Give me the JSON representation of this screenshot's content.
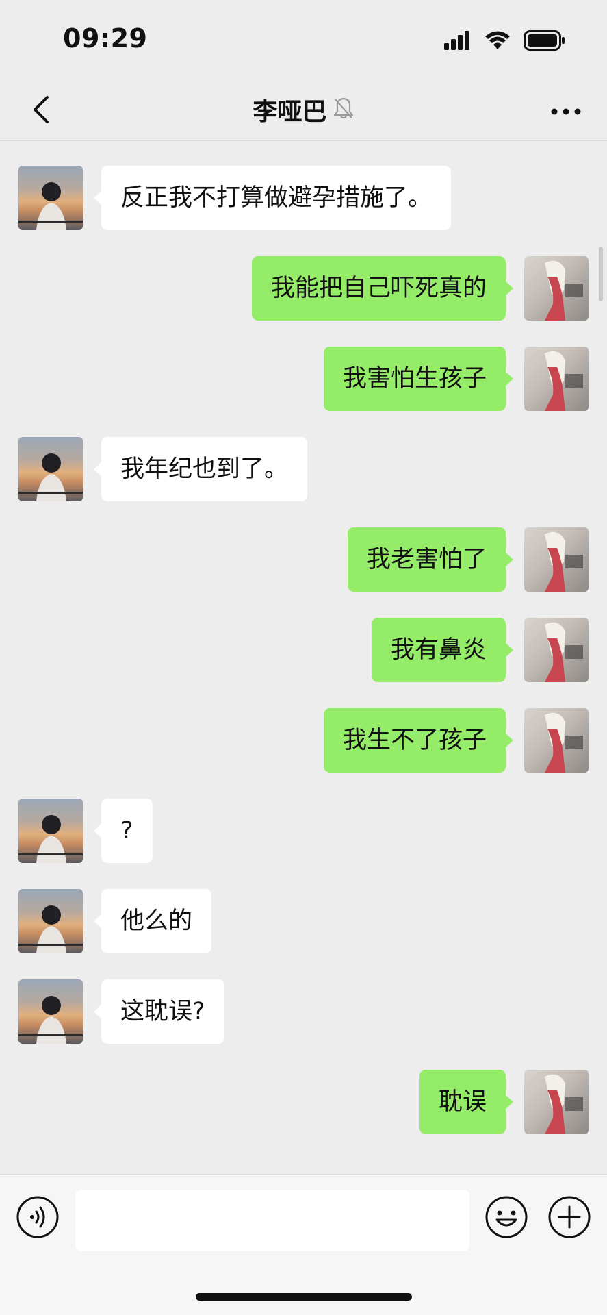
{
  "status_bar": {
    "time": "09:29",
    "icons": [
      "cellular-signal-icon",
      "wifi-icon",
      "battery-icon"
    ]
  },
  "nav": {
    "title": "李哑巴",
    "icons": [
      "back-chevron-icon",
      "mute-bell-icon",
      "more-dots-icon"
    ]
  },
  "messages": [
    {
      "side": "left",
      "text": "反正我不打算做避孕措施了。"
    },
    {
      "side": "right",
      "text": "我能把自己吓死真的"
    },
    {
      "side": "right",
      "text": "我害怕生孩子"
    },
    {
      "side": "left",
      "text": "我年纪也到了。"
    },
    {
      "side": "right",
      "text": "我老害怕了"
    },
    {
      "side": "right",
      "text": "我有鼻炎"
    },
    {
      "side": "right",
      "text": "我生不了孩子"
    },
    {
      "side": "left",
      "text": "?"
    },
    {
      "side": "left",
      "text": "他么的"
    },
    {
      "side": "left",
      "text": "这耽误?"
    },
    {
      "side": "right",
      "text": "耽误"
    }
  ],
  "input_bar": {
    "value": "",
    "icons": [
      "voice-icon",
      "emoji-icon",
      "plus-icon"
    ]
  },
  "colors": {
    "background": "#ededed",
    "sent_bubble": "#95ec69",
    "received_bubble": "#ffffff"
  }
}
